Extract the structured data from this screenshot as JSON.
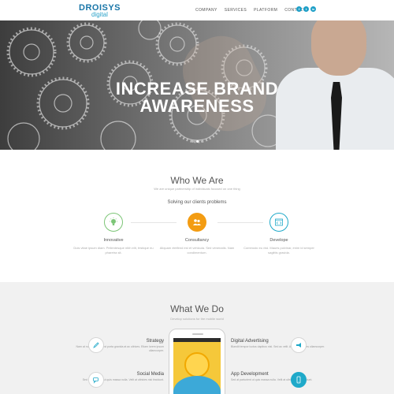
{
  "header": {
    "logo_top": "DROISYS",
    "logo_bottom": "digital",
    "nav": [
      "COMPANY",
      "SERVICES",
      "PLATFORM",
      "CONTACT"
    ],
    "social": [
      {
        "icon": "facebook-icon",
        "glyph": "f"
      },
      {
        "icon": "twitter-icon",
        "glyph": "t"
      },
      {
        "icon": "linkedin-icon",
        "glyph": "in"
      }
    ]
  },
  "hero": {
    "title_line1": "INCREASE BRAND",
    "title_line2": "AWARENESS",
    "slides": 3,
    "active_slide": 1
  },
  "who": {
    "title": "Who We Are",
    "subtitle": "We are unique partnership of individuals focused on one thing",
    "subheading": "Solving our clients problems",
    "features": [
      {
        "label": "Innovative",
        "text": "Duis vitae ipsum diam. Pellentesque nibh elit, tristique eu pharetra sit.",
        "icon": "lightbulb-icon",
        "color": "#7cc576"
      },
      {
        "label": "Consultancy",
        "text": "Aliquam eleifend est et vehicula. Sed venenatis. Nam condimentum.",
        "icon": "people-icon",
        "color": "#f39c12"
      },
      {
        "label": "Develope",
        "text": "Commodo eu nisl. Mauris pulvinar, enim id semper sagittis gravida.",
        "icon": "code-icon",
        "color": "#1fa9c9"
      }
    ]
  },
  "what": {
    "title": "What We Do",
    "subtitle": "Develop solutions for the mobile world",
    "services": [
      {
        "title": "Strategy",
        "text": "Nam at nulla sit amet est porta gravida at ac ultrices. Etiam lorem ipsum ullamcorper.",
        "icon": "pen-icon"
      },
      {
        "title": "Social Media",
        "text": "Sed at parturient ut quis massa nulla. Velit at ultricies nisi tincidunt.",
        "icon": "chat-icon"
      },
      {
        "title": "Digital Advertising",
        "text": "Blandit tempor luctus dapibus nisl. Sed ac velit. Aenean sodales ullamcorper.",
        "icon": "megaphone-icon"
      },
      {
        "title": "App Development",
        "text": "Sed at parturient ut quis massa nulla. Velit at ultricies nisi tincidunt.",
        "icon": "smartphone-icon"
      }
    ]
  }
}
